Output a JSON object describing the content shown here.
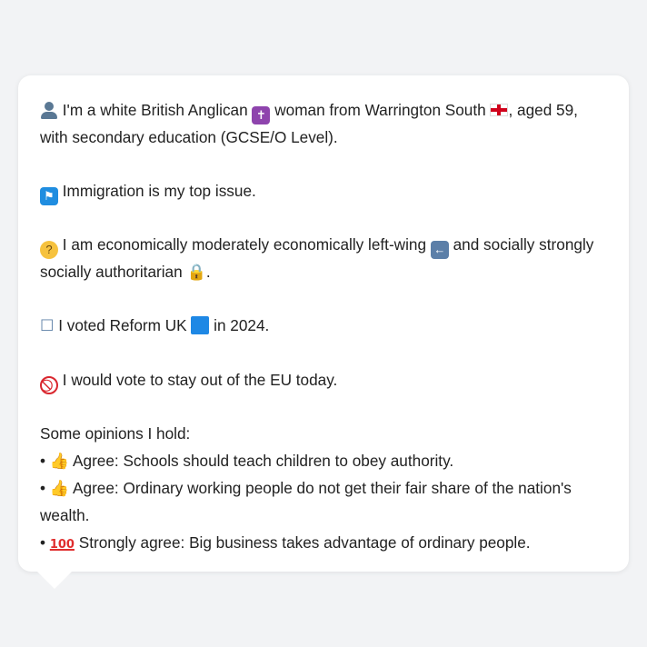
{
  "profile": {
    "identity": {
      "icon": "bust-in-silhouette-icon",
      "text_1": "I'm a white British Anglican",
      "religion_icon": "latin-cross-icon",
      "text_2": "woman from Warrington South",
      "flag_icon": "england-flag-icon",
      "text_3": ", aged 59, with secondary education (GCSE/O Level)."
    },
    "issue": {
      "icon": "passport-control-icon",
      "text": "Immigration is my top issue."
    },
    "ideology": {
      "icon": "thinking-face-icon",
      "text_1": "I am economically moderately economically left-wing",
      "left_icon": "left-arrow-icon",
      "text_2": "and socially strongly socially authoritarian",
      "lock_icon": "lock-icon",
      "text_3": "."
    },
    "vote": {
      "icon": "ballot-box-icon",
      "text_1": "I voted Reform UK",
      "party_icon": "blue-square-icon",
      "text_2": "in 2024."
    },
    "eu": {
      "icon": "no-entry-icon",
      "text": "I would vote to stay out of the EU today."
    },
    "opinions": {
      "heading": "Some opinions I hold:",
      "items": [
        {
          "bullet": "•",
          "icon": "thumbs-up-icon",
          "text": "Agree: Schools should teach children to obey authority."
        },
        {
          "bullet": "•",
          "icon": "thumbs-up-icon",
          "text": "Agree: Ordinary working people do not get their fair share of the nation's wealth."
        },
        {
          "bullet": "•",
          "icon": "hundred-points-icon",
          "glyph": "100",
          "text": "Strongly agree: Big business takes advantage of ordinary people."
        }
      ]
    }
  },
  "colors": {
    "background": "#f2f3f5",
    "bubble": "#ffffff",
    "text": "#222222"
  }
}
